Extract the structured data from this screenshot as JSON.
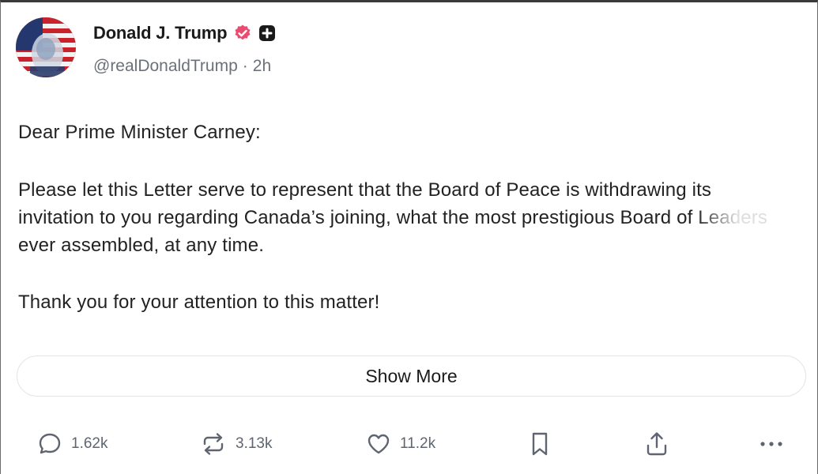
{
  "post": {
    "author": {
      "display_name": "Donald J. Trump",
      "handle": "@realDonaldTrump",
      "separator": "·",
      "time": "2h",
      "avatar_icon": "avatar-flag-portrait",
      "verified_icon": "verified-check-icon",
      "badge_icon": "plus-badge-icon"
    },
    "body": {
      "greeting": "Dear Prime Minister Carney:",
      "main": "Please let this Letter serve to represent that the Board of Peace is withdrawing its invitation to you regarding Canada’s joining, what the most prestigious Board of Leaders ever assembled, at any time.",
      "closing": "Thank you for your attention to this matter!"
    },
    "show_more_label": "Show More",
    "actions": {
      "replies": "1.62k",
      "retruths": "3.13k",
      "likes": "11.2k"
    },
    "icons": {
      "reply": "reply-bubble-icon",
      "retruth": "retruth-arrows-icon",
      "like": "heart-icon",
      "bookmark": "bookmark-icon",
      "share": "share-upload-icon",
      "more": "more-dots-icon"
    },
    "colors": {
      "verified": "#ea4b6e",
      "text": "#1a1a1a",
      "muted": "#6b7079",
      "icon": "#5f6570"
    }
  }
}
